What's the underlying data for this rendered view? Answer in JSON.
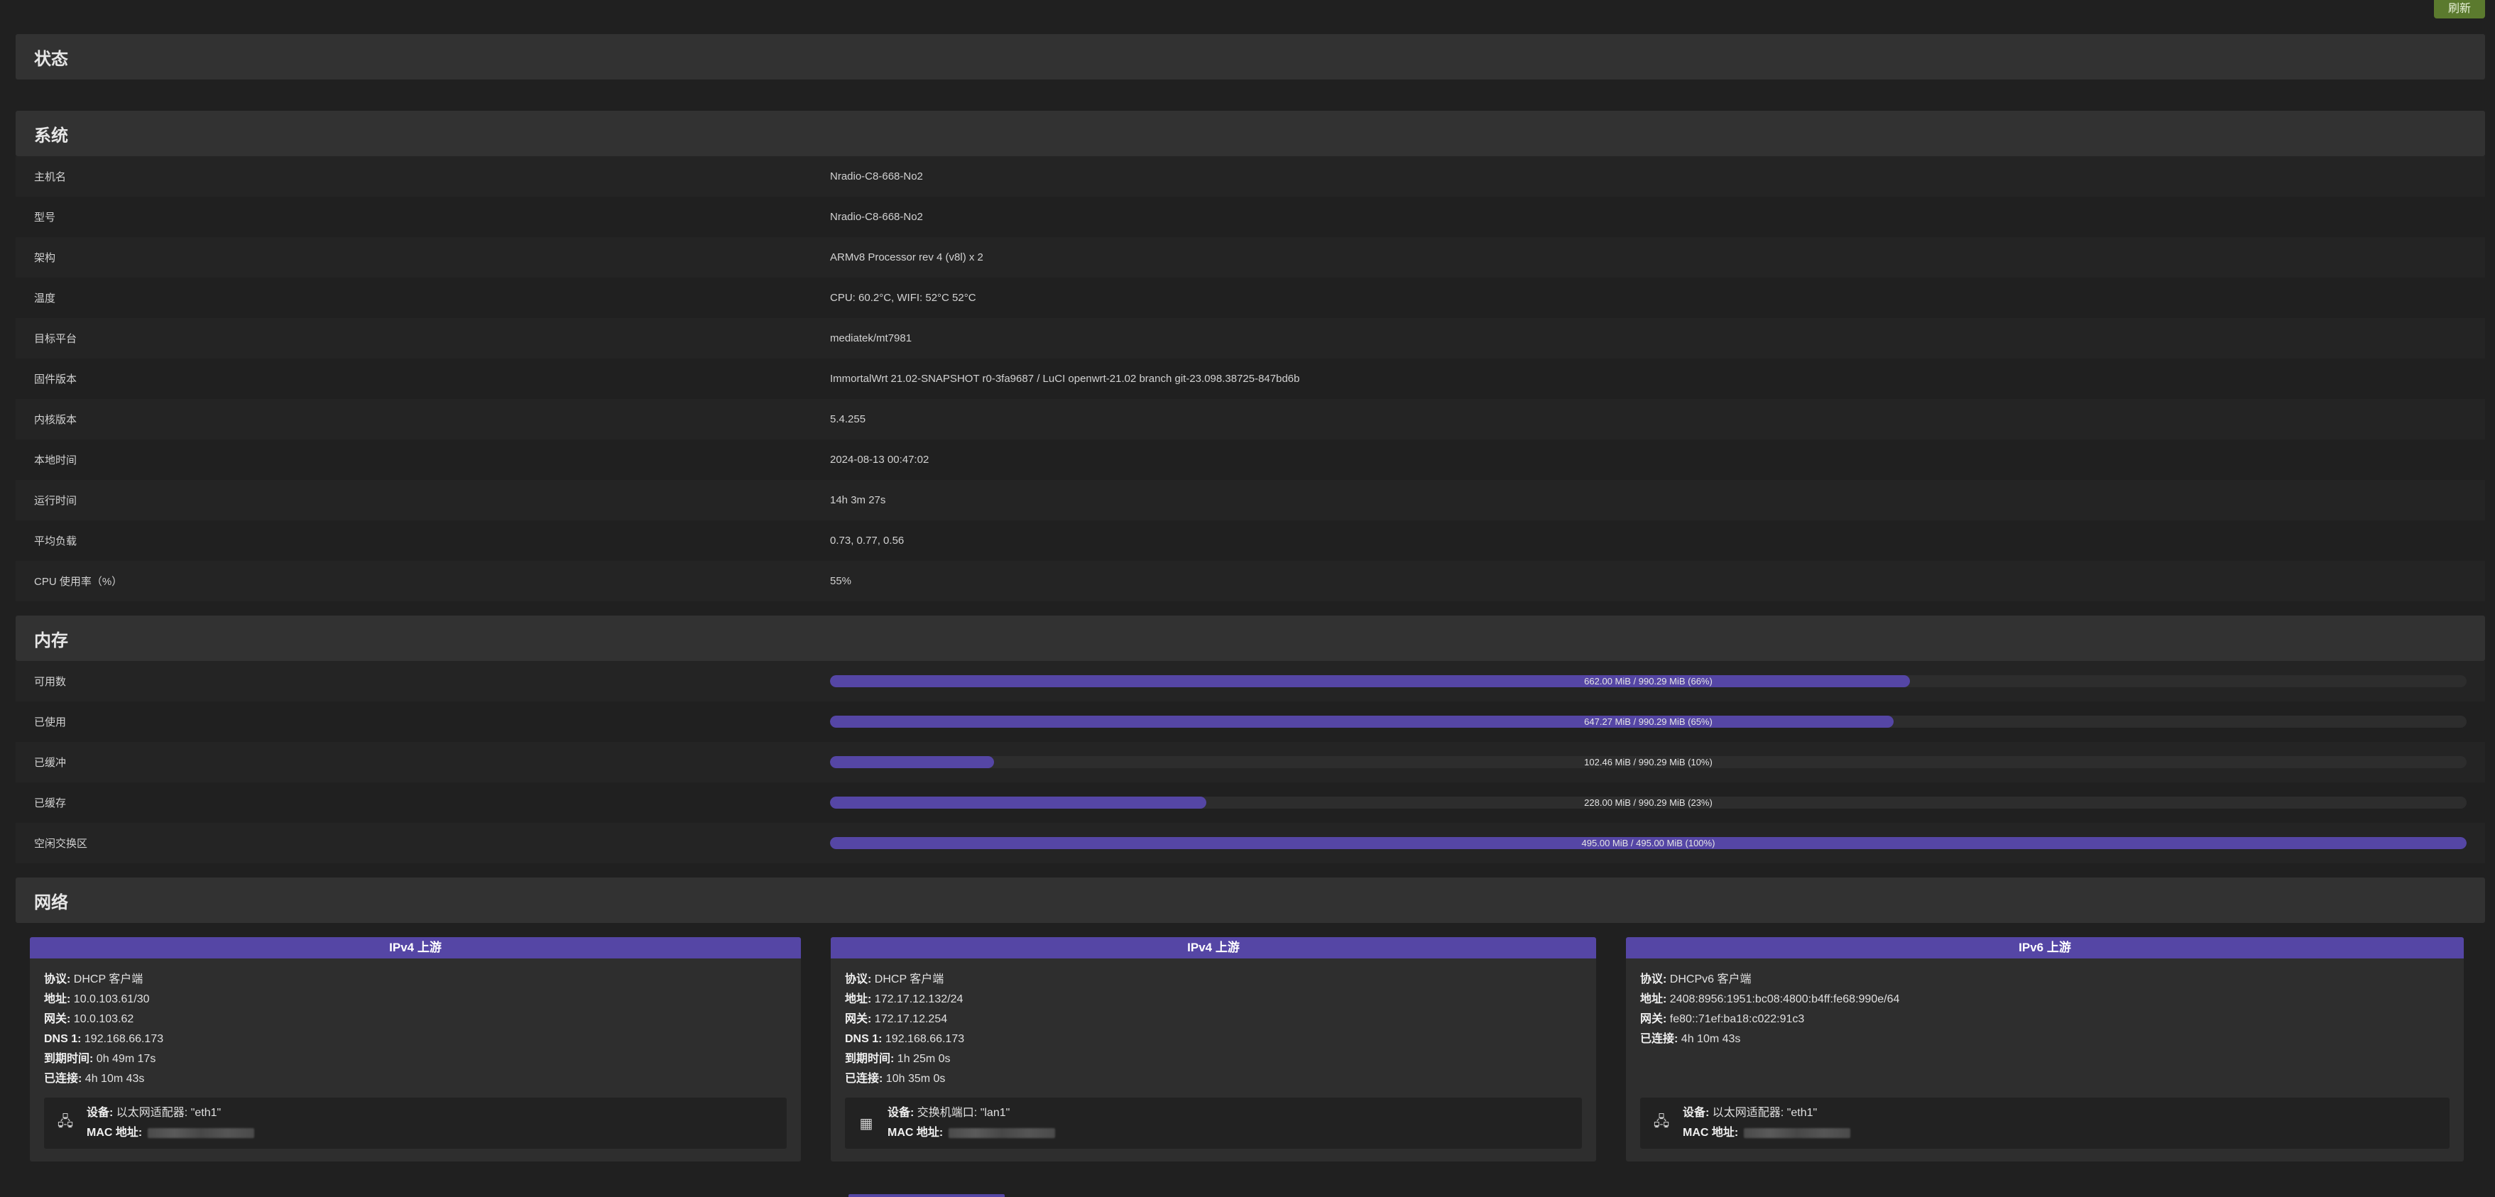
{
  "toolbar": {
    "refresh_label": "刷新"
  },
  "page": {
    "title": "状态"
  },
  "system": {
    "title": "系统",
    "rows": [
      {
        "label": "主机名",
        "value": "Nradio-C8-668-No2"
      },
      {
        "label": "型号",
        "value": "Nradio-C8-668-No2"
      },
      {
        "label": "架构",
        "value": "ARMv8 Processor rev 4 (v8l) x 2"
      },
      {
        "label": "温度",
        "value": "CPU: 60.2°C, WIFI: 52°C 52°C"
      },
      {
        "label": "目标平台",
        "value": "mediatek/mt7981"
      },
      {
        "label": "固件版本",
        "value": "ImmortalWrt 21.02-SNAPSHOT r0-3fa9687 / LuCI openwrt-21.02 branch git-23.098.38725-847bd6b"
      },
      {
        "label": "内核版本",
        "value": "5.4.255"
      },
      {
        "label": "本地时间",
        "value": "2024-08-13 00:47:02"
      },
      {
        "label": "运行时间",
        "value": "14h 3m 27s"
      },
      {
        "label": "平均负载",
        "value": "0.73, 0.77, 0.56"
      },
      {
        "label": "CPU 使用率（%）",
        "value": "55%"
      }
    ]
  },
  "memory": {
    "title": "内存",
    "rows": [
      {
        "label": "可用数",
        "text": "662.00 MiB / 990.29 MiB (66%)",
        "fraction": 0.66
      },
      {
        "label": "已使用",
        "text": "647.27 MiB / 990.29 MiB (65%)",
        "fraction": 0.65
      },
      {
        "label": "已缓冲",
        "text": "102.46 MiB / 990.29 MiB (10%)",
        "fraction": 0.1
      },
      {
        "label": "已缓存",
        "text": "228.00 MiB / 990.29 MiB (23%)",
        "fraction": 0.23
      },
      {
        "label": "空闲交换区",
        "text": "495.00 MiB / 495.00 MiB (100%)",
        "fraction": 1.0
      }
    ]
  },
  "network": {
    "title": "网络",
    "cards": [
      {
        "title": "IPv4 上游",
        "fields": [
          {
            "k": "协议:",
            "v": "DHCP 客户端"
          },
          {
            "k": "地址:",
            "v": "10.0.103.61/30"
          },
          {
            "k": "网关:",
            "v": "10.0.103.62"
          },
          {
            "k": "DNS 1:",
            "v": "192.168.66.173"
          },
          {
            "k": "到期时间:",
            "v": "0h 49m 17s"
          },
          {
            "k": "已连接:",
            "v": "4h 10m 43s"
          }
        ],
        "device": {
          "icon": "ethernet-adapter-icon",
          "glyph": "🖧",
          "label": "设备:",
          "value": "以太网适配器: \"eth1\"",
          "mac_label": "MAC 地址:"
        }
      },
      {
        "title": "IPv4 上游",
        "fields": [
          {
            "k": "协议:",
            "v": "DHCP 客户端"
          },
          {
            "k": "地址:",
            "v": "172.17.12.132/24"
          },
          {
            "k": "网关:",
            "v": "172.17.12.254"
          },
          {
            "k": "DNS 1:",
            "v": "192.168.66.173"
          },
          {
            "k": "到期时间:",
            "v": "1h 25m 0s"
          },
          {
            "k": "已连接:",
            "v": "10h 35m 0s"
          }
        ],
        "device": {
          "icon": "switch-port-icon",
          "glyph": "▦",
          "label": "设备:",
          "value": "交换机端口: \"lan1\"",
          "mac_label": "MAC 地址:"
        }
      },
      {
        "title": "IPv6 上游",
        "fields": [
          {
            "k": "协议:",
            "v": "DHCPv6 客户端"
          },
          {
            "k": "地址:",
            "v": "2408:8956:1951:bc08:4800:b4ff:fe68:990e/64"
          },
          {
            "k": "网关:",
            "v": "fe80::71ef:ba18:c022:91c3"
          },
          {
            "k": "已连接:",
            "v": "4h 10m 43s"
          }
        ],
        "device": {
          "icon": "ethernet-adapter-icon",
          "glyph": "🖧",
          "label": "设备:",
          "value": "以太网适配器: \"eth1\"",
          "mac_label": "MAC 地址:"
        }
      }
    ]
  },
  "colors": {
    "accent": "#5546a5",
    "refresh": "#5b7a2e",
    "background": "#202020"
  }
}
